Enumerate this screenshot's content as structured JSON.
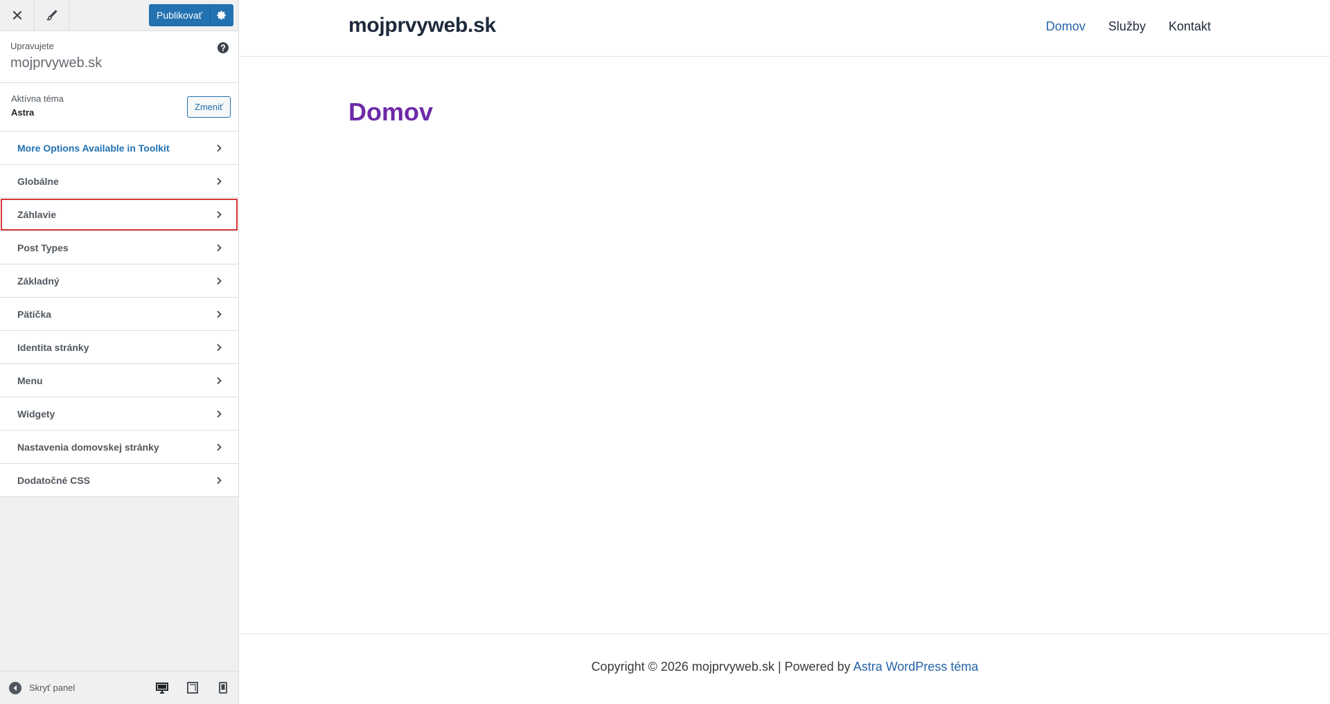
{
  "sidebar": {
    "publish_label": "Publikovať",
    "editing_label": "Upravujete",
    "editing_site": "mojprvyweb.sk",
    "theme_label": "Aktívna téma",
    "theme_name": "Astra",
    "change_label": "Zmeniť",
    "items": [
      {
        "label": "More Options Available in Toolkit"
      },
      {
        "label": "Globálne"
      },
      {
        "label": "Záhlavie"
      },
      {
        "label": "Post Types"
      },
      {
        "label": "Základný"
      },
      {
        "label": "Pätička"
      },
      {
        "label": "Identita stránky"
      },
      {
        "label": "Menu"
      },
      {
        "label": "Widgety"
      },
      {
        "label": "Nastavenia domovskej stránky"
      },
      {
        "label": "Dodatočné CSS"
      }
    ],
    "collapse_label": "Skryť panel"
  },
  "preview": {
    "site_title": "mojprvyweb.sk",
    "nav": [
      "Domov",
      "Služby",
      "Kontakt"
    ],
    "page_title": "Domov",
    "footer_text": "Copyright © 2026 mojprvyweb.sk | Powered by ",
    "footer_link": "Astra WordPress téma"
  },
  "colors": {
    "accent": "#2271b1",
    "highlight": "#d63638",
    "page_title": "#6d2aa8",
    "nav_active": "#2563a8"
  }
}
